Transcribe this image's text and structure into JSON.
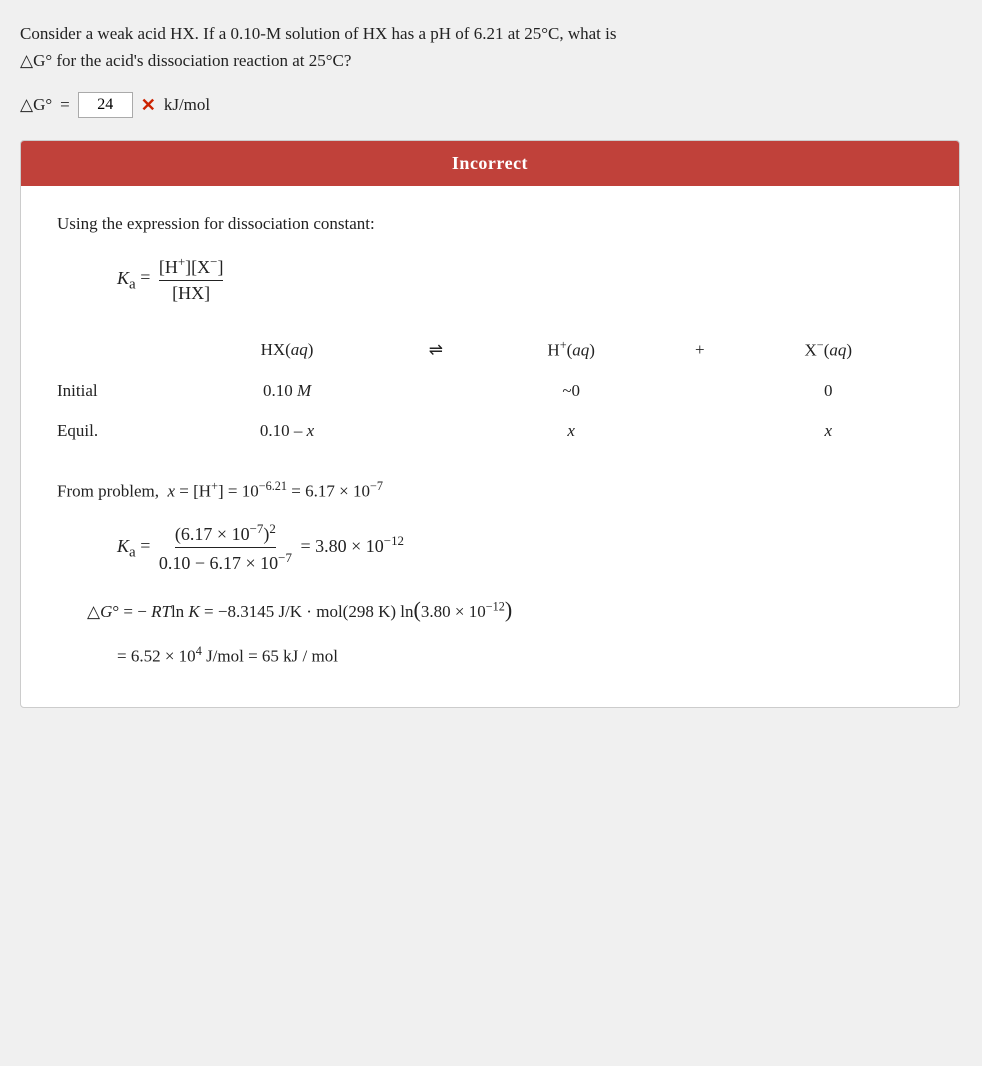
{
  "question": {
    "text_line1": "Consider a weak acid HX. If a 0.10-M solution of HX has a pH of 6.21 at 25°C, what is",
    "text_line2": "△G° for the acid's dissociation reaction at 25°C?",
    "delta_g_label": "△G°",
    "equals": "=",
    "answer_value": "24",
    "wrong_icon": "✕",
    "unit": "kJ/mol"
  },
  "solution": {
    "header": "Incorrect",
    "intro": "Using the expression for dissociation constant:",
    "ka_label": "Ka",
    "reaction_header": {
      "hx": "HX(aq)",
      "arrow": "⇌",
      "hplus": "H⁺(aq)",
      "plus": "+",
      "xminus": "X⁻(aq)"
    },
    "table": {
      "rows": [
        {
          "label": "Initial",
          "hx_val": "0.10 M",
          "hp_val": "~0",
          "xm_val": "0"
        },
        {
          "label": "Equil.",
          "hx_val": "0.10 – x",
          "hp_val": "x",
          "xm_val": "x"
        }
      ]
    },
    "from_problem": "From problem,  x = [H⁺] = 10⁻⁶·²¹ = 6.17 × 10⁻⁷",
    "ka_calc_label": "Ka",
    "ka_numerator": "(6.17 × 10⁻⁷)²",
    "ka_denominator": "0.10 – 6.17 × 10⁻⁷",
    "ka_result": "= 3.80 × 10⁻¹²",
    "delta_g_eq": "△G° = – RT ln K = –8.3145 J/K · mol(298 K) ln(3.80 × 10⁻¹²)",
    "result": "= 6.52 × 10⁴ J/mol = 65 kJ / mol"
  }
}
